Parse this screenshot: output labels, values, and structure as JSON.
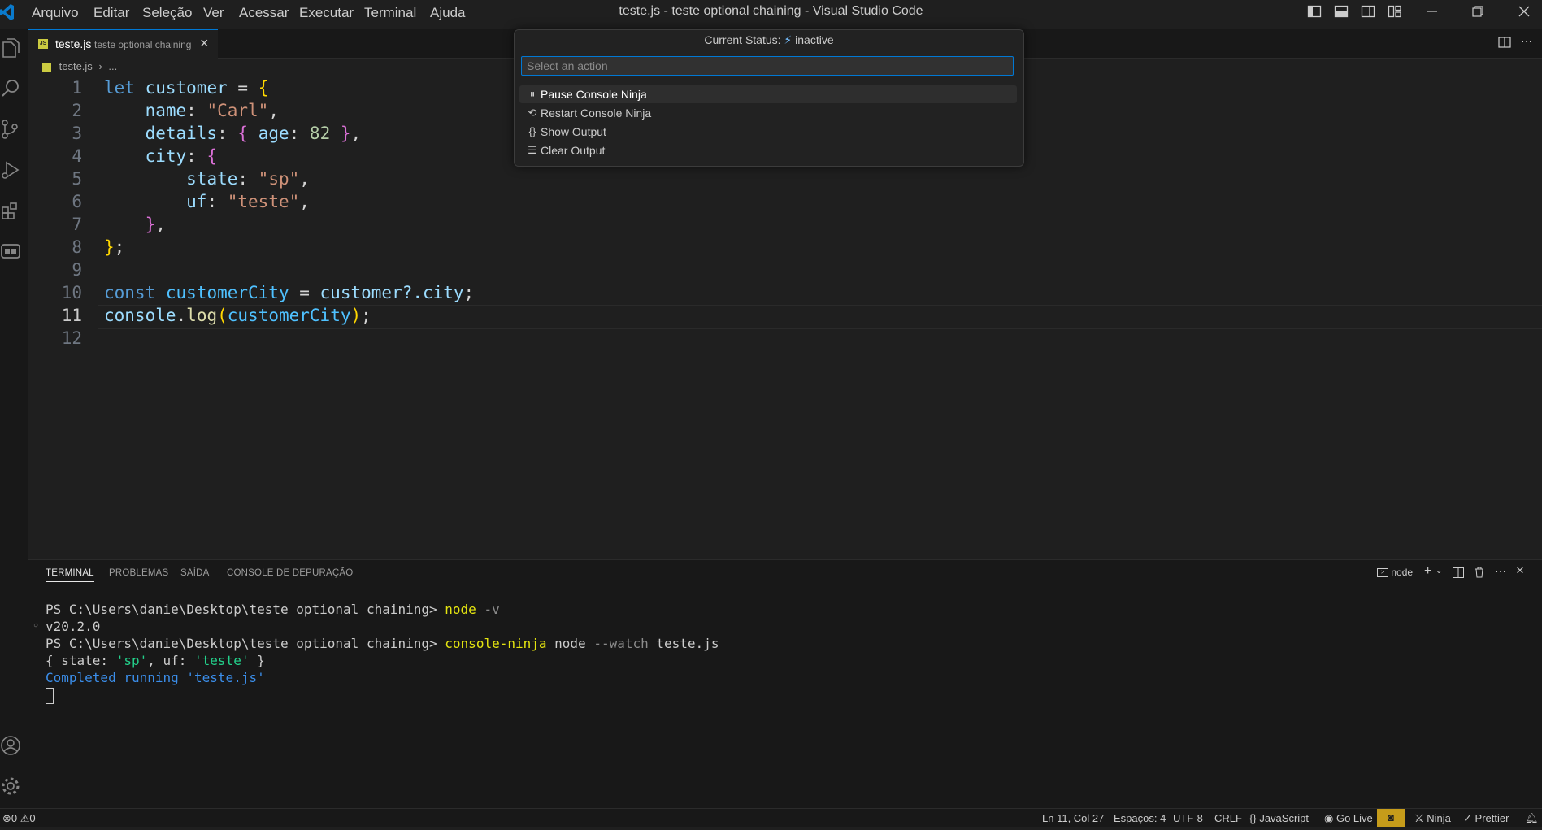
{
  "window": {
    "title": "teste.js - teste optional chaining - Visual Studio Code",
    "menu": [
      "Arquivo",
      "Editar",
      "Seleção",
      "Ver",
      "Acessar",
      "Executar",
      "Terminal",
      "Ajuda"
    ]
  },
  "tab": {
    "filename": "teste.js",
    "folder": "teste optional chaining",
    "badge": "JS"
  },
  "breadcrumb": {
    "file": "teste.js",
    "more": "..."
  },
  "editor": {
    "active_line": 11,
    "line_numbers": [
      "1",
      "2",
      "3",
      "4",
      "5",
      "6",
      "7",
      "8",
      "9",
      "10",
      "11",
      "12"
    ],
    "code": {
      "l1": {
        "kw": "let",
        "var": "customer",
        "op": " = ",
        "brace": "{"
      },
      "l2": {
        "key": "name",
        "colon": ": ",
        "str": "\"Carl\"",
        "comma": ","
      },
      "l3": {
        "key": "details",
        "colon": ": ",
        "open": "{",
        "inner_key": " age",
        "inner_colon": ": ",
        "num": "82",
        "close": " }",
        "comma": ","
      },
      "l4": {
        "key": "city",
        "colon": ": ",
        "open": "{"
      },
      "l5": {
        "key": "state",
        "colon": ": ",
        "str": "\"sp\"",
        "comma": ","
      },
      "l6": {
        "key": "uf",
        "colon": ": ",
        "str": "\"teste\"",
        "comma": ","
      },
      "l7": {
        "close": "}",
        "comma": ","
      },
      "l8": {
        "close": "}",
        "semi": ";"
      },
      "l10": {
        "kw": "const",
        "var": "customerCity",
        "op": " = ",
        "obj": "customer",
        "chain": "?.city",
        "semi": ";"
      },
      "l11": {
        "obj": "console",
        "dot": ".",
        "fn": "log",
        "open": "(",
        "arg": "customerCity",
        "close": ")",
        "semi": ";"
      }
    }
  },
  "quickpick": {
    "status_label": "Current Status:",
    "status_value": "inactive",
    "placeholder": "Select an action",
    "items": [
      {
        "icon": "pause-icon",
        "label": "Pause Console Ninja"
      },
      {
        "icon": "restart-icon",
        "label": "Restart Console Ninja"
      },
      {
        "icon": "braces-icon",
        "label": "Show Output"
      },
      {
        "icon": "clear-all-icon",
        "label": "Clear Output"
      }
    ]
  },
  "panel": {
    "tabs": [
      "TERMINAL",
      "PROBLEMAS",
      "SAÍDA",
      "CONSOLE DE DEPURAÇÃO"
    ],
    "terminal_name": "node",
    "terminal": {
      "prompt1": "PS C:\\Users\\danie\\Desktop\\teste optional chaining> ",
      "cmd1": "node",
      "arg1": " -v",
      "out1": "v20.2.0",
      "prompt2": "PS C:\\Users\\danie\\Desktop\\teste optional chaining> ",
      "cmd2": "console-ninja",
      "arg2a": " node ",
      "arg2b": "--watch",
      "arg2c": " teste.js",
      "out2_open": "{ state: ",
      "out2_v1": "'sp'",
      "out2_mid": ", uf: ",
      "out2_v2": "'teste'",
      "out2_close": " }",
      "out3": "Completed running 'teste.js'"
    }
  },
  "statusbar": {
    "errors": "0",
    "warnings": "0",
    "position": "Ln 11, Col 27",
    "spaces": "Espaços: 4",
    "encoding": "UTF-8",
    "eol": "CRLF",
    "language": "JavaScript",
    "golive": "Go Live",
    "ninja": "Ninja",
    "prettier": "Prettier"
  },
  "colors": {
    "accent": "#0078d4",
    "background": "#1f1f1f",
    "js_badge": "#cbcb41"
  }
}
